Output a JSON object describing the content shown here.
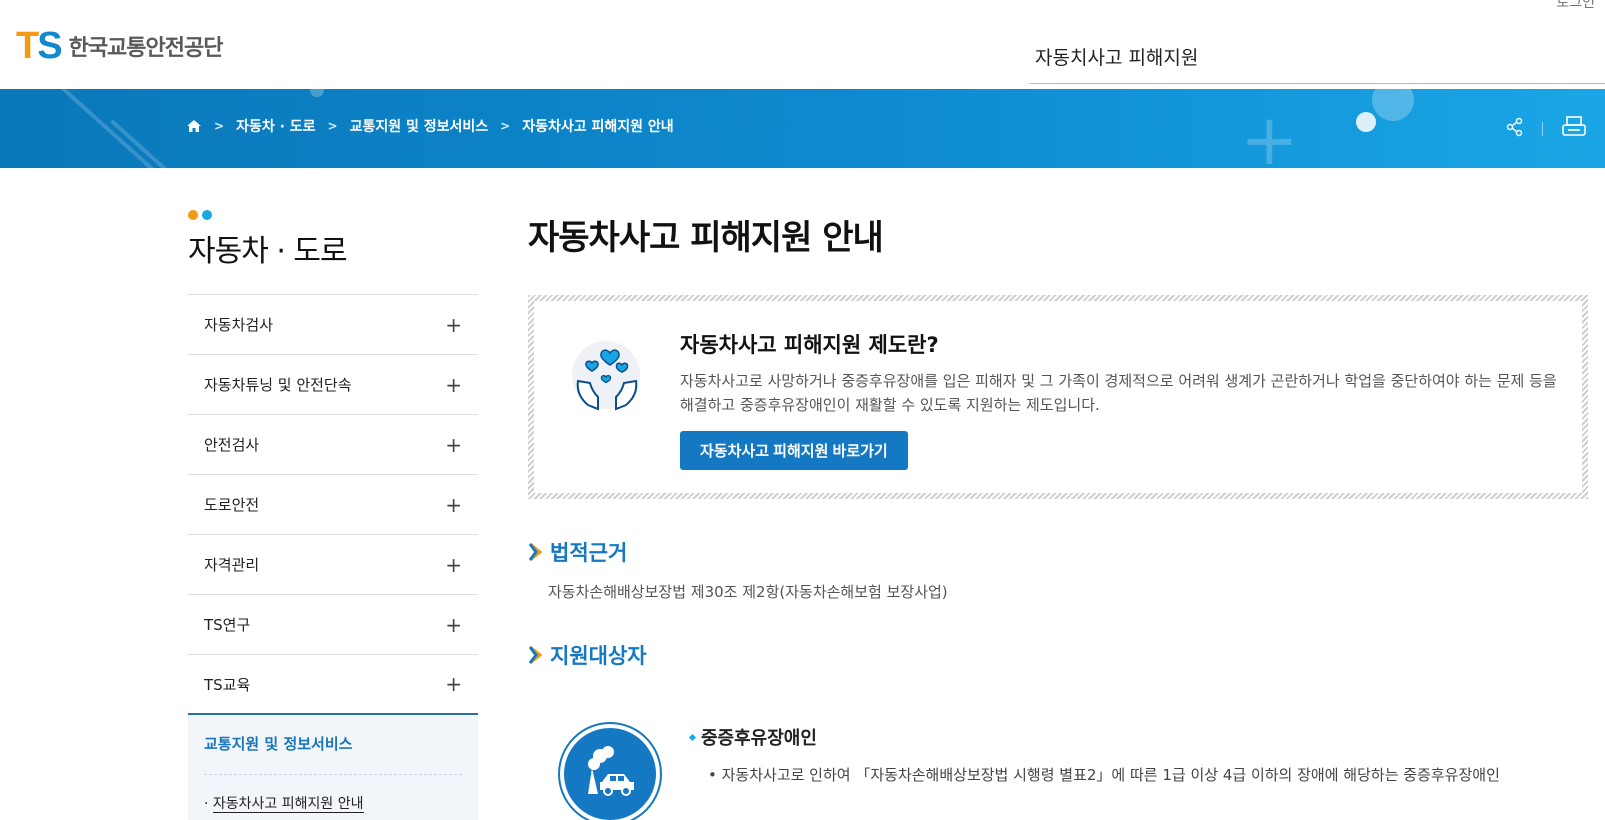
{
  "header": {
    "logo_ts_t": "T",
    "logo_ts_s": "S",
    "logo_name": "한국교통안전공단",
    "login_label": "로그인",
    "search_value": "자동치사고 피해지원"
  },
  "breadcrumb": {
    "items": [
      "자동차 · 도로",
      "교통지원 및 정보서비스",
      "자동차사고 피해지원 안내"
    ],
    "home_icon": "home-icon",
    "share_icon": "share-icon",
    "print_icon": "print-icon"
  },
  "lnb": {
    "title": "자동차 · 도로",
    "dot_colors": [
      "#f29a13",
      "#1aa6e6"
    ],
    "items": [
      {
        "label": "자동차검사"
      },
      {
        "label": "자동차튜닝 및 안전단속"
      },
      {
        "label": "안전검사"
      },
      {
        "label": "도로안전"
      },
      {
        "label": "자격관리"
      },
      {
        "label": "TS연구"
      },
      {
        "label": "TS교육"
      }
    ],
    "plus_symbol": "+",
    "active_section": "교통지원 및 정보서비스",
    "active_link": "자동차사고 피해지원 안내"
  },
  "content": {
    "page_title": "자동차사고 피해지원 안내",
    "intro": {
      "title": "자동차사고 피해지원 제도란?",
      "body": "자동차사고로 사망하거나 중증후유장애를 입은 피해자 및 그 가족이 경제적으로 어려워 생계가 곤란하거나 학업을 중단하여야 하는 문제 등을 해결하고 중증후유장애인이 재활할 수 있도록 지원하는 제도입니다.",
      "button": "자동차사고 피해지원 바로가기"
    },
    "legal": {
      "title": "법적근거",
      "body": "자동차손해배상보장법 제30조 제2항(자동차손해보험 보장사업)"
    },
    "target": {
      "title": "지원대상자",
      "item_title": "중증후유장애인",
      "item_desc": "• 자동차사고로 인하여 「자동차손해배상보장법 시행령 별표2」에 따른 1급 이상 4급 이하의 장애에 해당하는 중증후유장애인"
    }
  },
  "colors": {
    "brand_blue": "#1478c2",
    "brand_orange": "#f29a13",
    "band_start": "#0a78b9",
    "band_end": "#1aa6e6"
  }
}
